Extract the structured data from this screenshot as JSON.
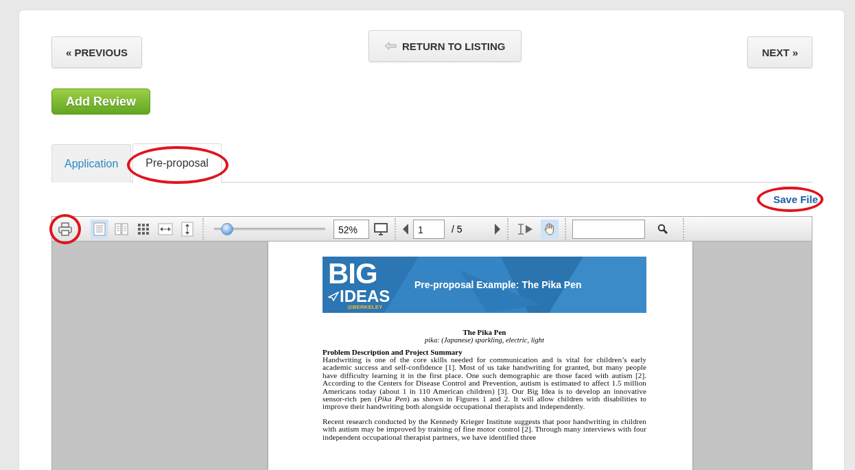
{
  "nav": {
    "previous": "« PREVIOUS",
    "return": "RETURN TO LISTING",
    "next": "NEXT »"
  },
  "add_review": "Add Review",
  "tabs": [
    {
      "label": "Application",
      "selected": false,
      "circled": false
    },
    {
      "label": "Pre-proposal",
      "selected": true,
      "circled": true
    }
  ],
  "save_file": {
    "label": "Save File",
    "circled": true
  },
  "toolbar": {
    "view_tools": [
      {
        "kind": "print",
        "selected": false,
        "circled": true
      },
      {
        "kind": "single-page",
        "selected": true,
        "circled": false
      },
      {
        "kind": "two-page",
        "selected": false,
        "circled": false
      },
      {
        "kind": "thumbnails",
        "selected": false,
        "circled": false
      },
      {
        "kind": "fit-width",
        "selected": false,
        "circled": false
      },
      {
        "kind": "fit-height",
        "selected": false,
        "circled": false
      }
    ],
    "zoom": {
      "level": 0.12,
      "value": "52%"
    },
    "page": {
      "value": "1",
      "total": "/ 5"
    },
    "cursor_tools": [
      {
        "kind": "text-select",
        "selected": false
      },
      {
        "kind": "hand",
        "selected": true
      }
    ]
  },
  "document": {
    "banner": {
      "logo_top": "BIG",
      "logo_bottom": "IDEAS",
      "logo_tag": "@BERKELEY",
      "title": "Pre-proposal Example: The Pika Pen"
    },
    "title": "The Pika Pen",
    "subtitle": "pika: (Japanese) sparkling, electric, light",
    "heading": "Problem Description and Project Summary",
    "paragraphs": [
      "Handwriting is one of the core skills needed for communication and is vital for children’s early academic success and self-confidence [1]. Most of us take handwriting for granted, but many people have difficulty learning it in the first place. One such demographic are those faced with autism [2]. According to the Centers for Disease Control and Prevention, autism is estimated to affect 1.5 million Americans today (about 1 in 110 American children) [3]. Our Big Idea is to develop an innovative sensor-rich pen (*Pika Pen*) as shown in Figures 1 and 2. It will allow children with disabilities to improve their handwriting both alongside occupational therapists and independently.",
      "Recent research conducted by the Kennedy Krieger Institute suggests that poor handwriting in children with autism may be improved by training of fine motor control [2]. Through many interviews with four independent occupational therapist partners, we have identified three"
    ]
  }
}
